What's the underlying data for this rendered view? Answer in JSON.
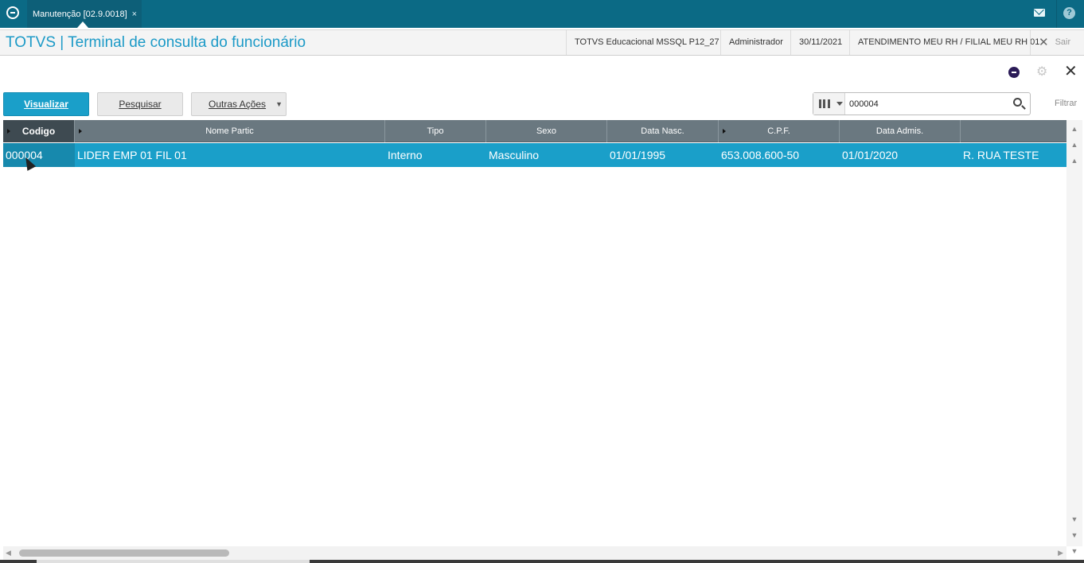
{
  "topbar": {
    "tab_label": "Manutenção [02.9.0018]",
    "tab_close": "×",
    "icons": [
      "app-logo-icon",
      "mail-icon",
      "help-icon"
    ],
    "help_glyph": "?"
  },
  "header": {
    "title": "TOTVS | Terminal de consulta do funcionário",
    "environment": "TOTVS Educacional MSSQL P12_27",
    "user": "Administrador",
    "date": "30/11/2021",
    "branch": "ATENDIMENTO MEU RH / FILIAL MEU RH 01",
    "exit_label": "Sair"
  },
  "toolbar": {
    "visualizar_label": "Visualizar",
    "pesquisar_label": "Pesquisar",
    "outras_acoes_label": "Outras Ações"
  },
  "search": {
    "value": "000004",
    "filter_label": "Filtrar"
  },
  "grid": {
    "columns": [
      "Codigo",
      "Nome  Partic",
      "Tipo",
      "Sexo",
      "Data Nasc.",
      "C.P.F.",
      "Data Admis.",
      ""
    ],
    "rows": [
      {
        "codigo": "000004",
        "nome": "LIDER EMP 01 FIL 01",
        "tipo": "Interno",
        "sexo": "Masculino",
        "data_nasc": "01/01/1995",
        "cpf": "653.008.600-50",
        "data_admis": "01/01/2020",
        "endereco": "R. RUA TESTE"
      }
    ]
  },
  "colors": {
    "topbar": "#0b6a85",
    "accent": "#1a9fc9",
    "grid_header": "#6a7880",
    "selected_row": "#1a9fc9"
  }
}
